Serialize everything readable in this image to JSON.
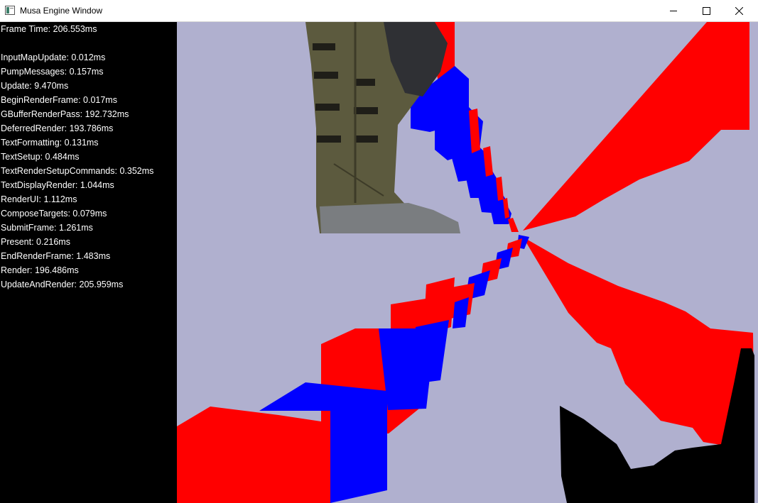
{
  "window": {
    "title": "Musa Engine Window",
    "controls": [
      "minimize-icon",
      "maximize-icon",
      "close-icon"
    ]
  },
  "debug": {
    "frame_time": "Frame Time: 206.553ms",
    "timings": [
      "InputMapUpdate: 0.012ms",
      "PumpMessages: 0.157ms",
      "Update: 9.470ms",
      "BeginRenderFrame: 0.017ms",
      "GBufferRenderPass: 192.732ms",
      "DeferredRender: 193.786ms",
      "TextFormatting: 0.131ms",
      "TextSetup: 0.484ms",
      "TextRenderSetupCommands: 0.352ms",
      "TextDisplayRender: 1.044ms",
      "RenderUI: 1.112ms",
      "ComposeTargets: 0.079ms",
      "SubmitFrame: 1.261ms",
      "Present: 0.216ms",
      "EndRenderFrame: 1.483ms",
      "Render: 196.486ms",
      "UpdateAndRender: 205.959ms"
    ]
  },
  "colors": {
    "background": "#b0b0cf",
    "cube_red": "#ff0000",
    "cube_blue": "#0000ff",
    "character": "#5c5a3e"
  }
}
